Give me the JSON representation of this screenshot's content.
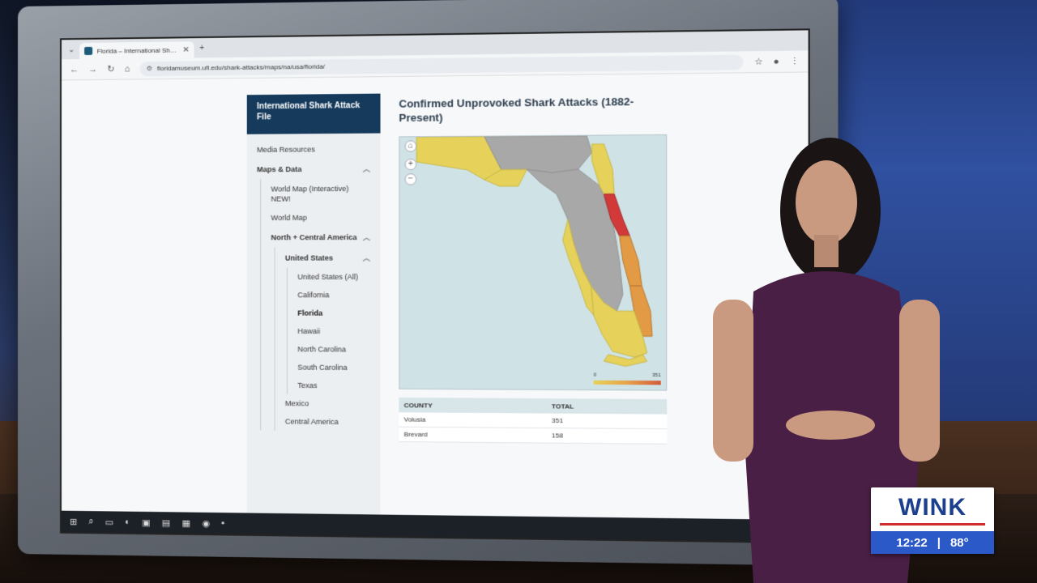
{
  "browser": {
    "tab_title": "Florida – International Shark At",
    "url": "floridamuseum.ufl.edu/shark-attacks/maps/na/usa/florida/"
  },
  "sidebar": {
    "header": "International Shark Attack File",
    "items": [
      {
        "label": "Media Resources"
      },
      {
        "label": "Maps & Data"
      },
      {
        "label": "World Map (Interactive) NEW!"
      },
      {
        "label": "World Map"
      },
      {
        "label": "North + Central America"
      },
      {
        "label": "United States"
      },
      {
        "label": "United States (All)"
      },
      {
        "label": "California"
      },
      {
        "label": "Florida"
      },
      {
        "label": "Hawaii"
      },
      {
        "label": "North Carolina"
      },
      {
        "label": "South Carolina"
      },
      {
        "label": "Texas"
      },
      {
        "label": "Mexico"
      },
      {
        "label": "Central America"
      }
    ]
  },
  "main": {
    "title": "Confirmed Unprovoked Shark Attacks (1882-Present)",
    "legend": {
      "min": "0",
      "max": "351"
    },
    "table": {
      "columns": [
        "COUNTY",
        "TOTAL"
      ],
      "rows": [
        {
          "county": "Volusia",
          "total": "351"
        },
        {
          "county": "Brevard",
          "total": "158"
        }
      ]
    }
  },
  "broadcast": {
    "logo": "WINK",
    "time": "12:22",
    "separator": "|",
    "temp": "88°"
  },
  "colors": {
    "sidebar_header": "#153a5c",
    "wink_blue": "#2b5ac8",
    "map_water": "#cfe3e6",
    "map_gray": "#a8a8a8",
    "map_yellow": "#e6d25a",
    "map_orange": "#e39a45",
    "map_red": "#d23a3a"
  }
}
